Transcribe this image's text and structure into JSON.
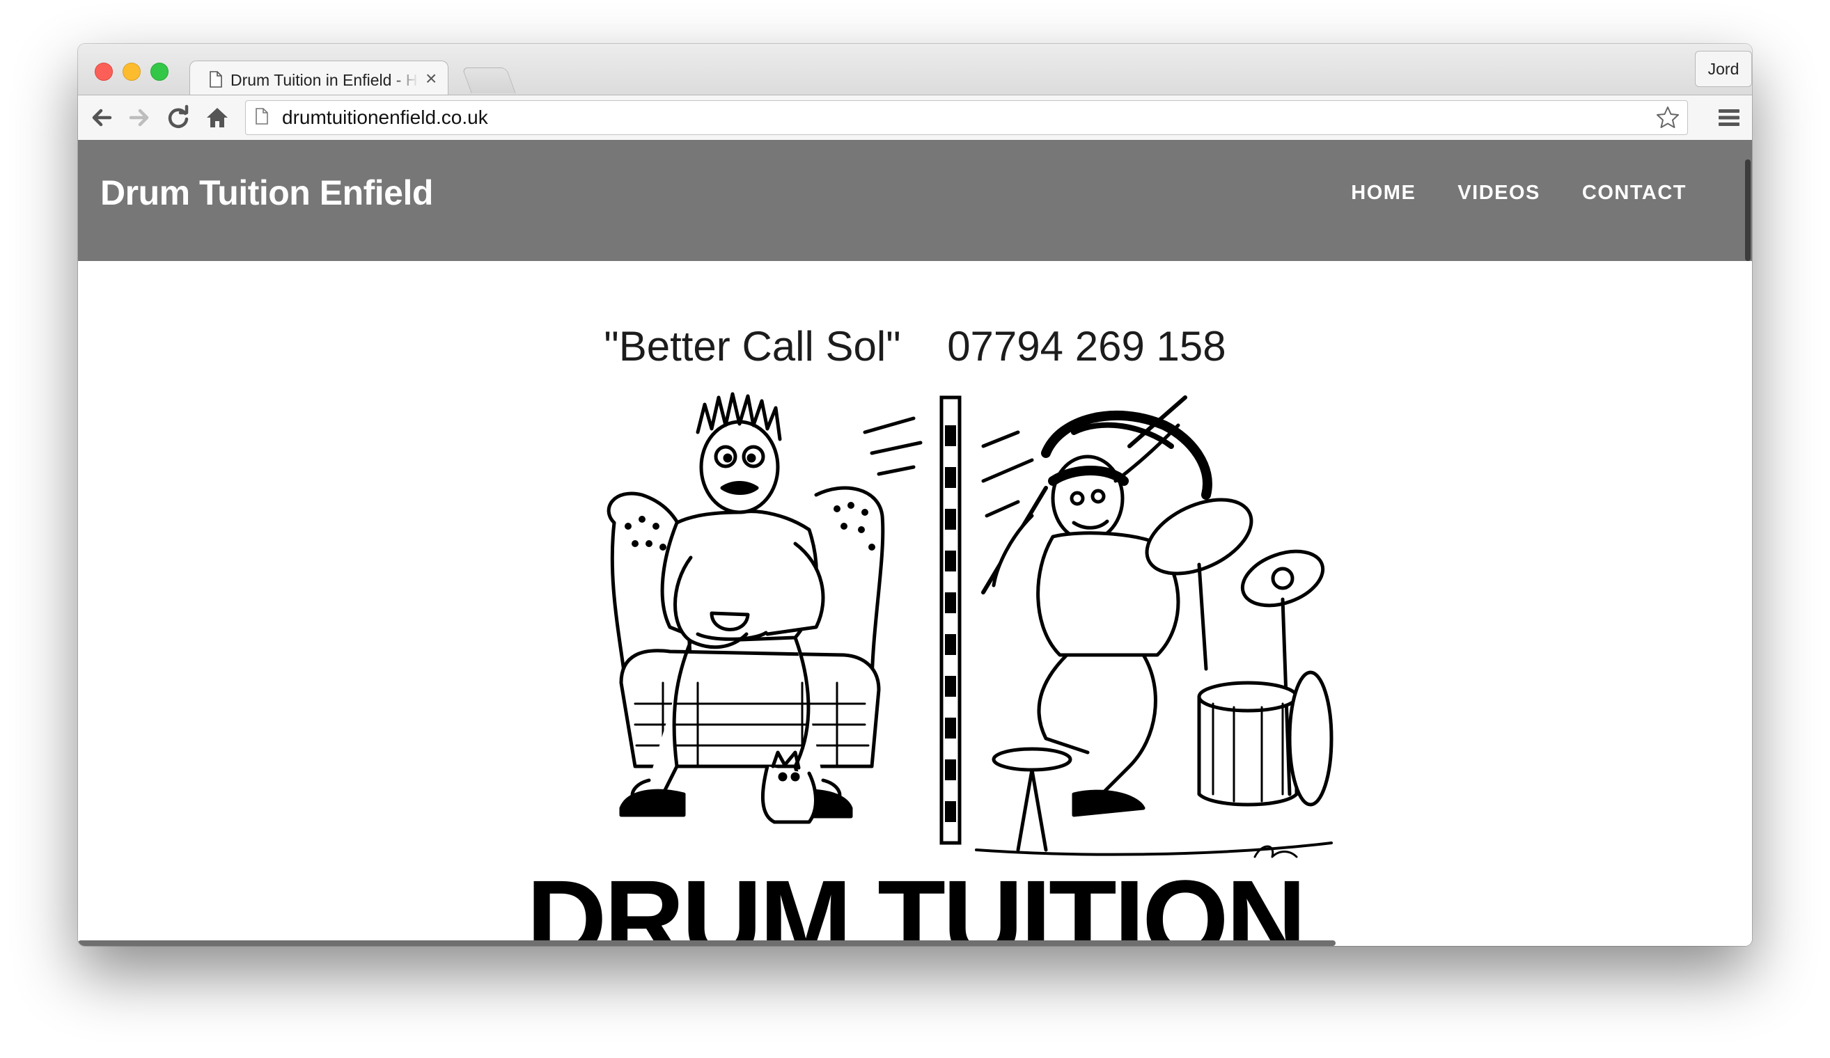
{
  "browser": {
    "tab_title": "Drum Tuition in Enfield - Home",
    "tab_close": "×",
    "profile_name": "Jord",
    "url": "drumtuitionenfield.co.uk"
  },
  "site": {
    "brand": "Drum Tuition Enfield",
    "nav": [
      "HOME",
      "VIDEOS",
      "CONTACT"
    ],
    "tagline_quote": "\"Better Call Sol\"",
    "tagline_phone": "07794 269 158",
    "hero_title": "DRUM TUITION"
  },
  "colors": {
    "header_bg": "#777777",
    "header_text": "#ffffff"
  },
  "icons": [
    "back-arrow-icon",
    "forward-arrow-icon",
    "reload-icon",
    "home-icon",
    "document-icon",
    "star-icon",
    "hamburger-menu-icon"
  ]
}
